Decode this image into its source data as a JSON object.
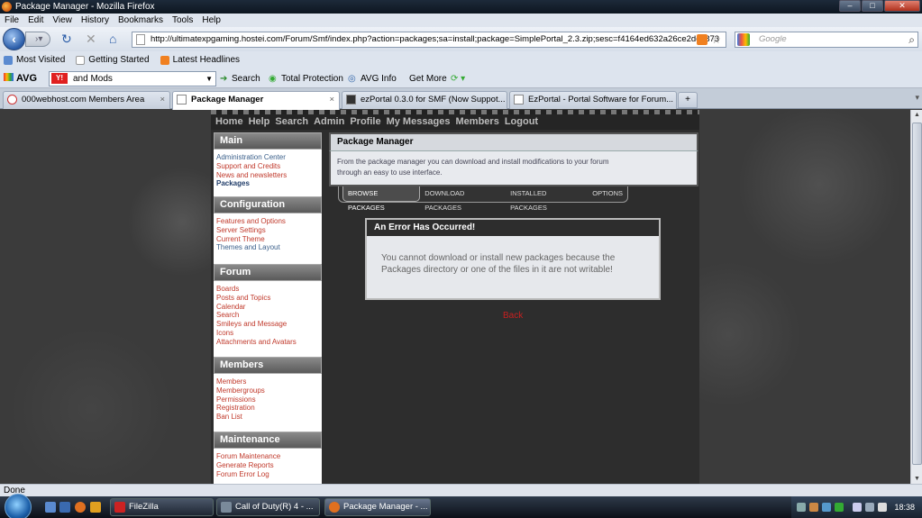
{
  "window": {
    "title": "Package Manager - Mozilla Firefox"
  },
  "menu": [
    "File",
    "Edit",
    "View",
    "History",
    "Bookmarks",
    "Tools",
    "Help"
  ],
  "nav": {
    "url": "http://ultimatexpgaming.hostei.com/Forum/Smf/index.php?action=packages;sa=install;package=SimplePortal_2.3.zip;sesc=f4164ed632a26ce2ddc873",
    "search_placeholder": "Google"
  },
  "bookmarks": [
    "Most Visited",
    "Getting Started",
    "Latest Headlines"
  ],
  "avg_toolbar": {
    "brand": "AVG",
    "search_value": "and Mods",
    "search_label": "Search",
    "total_protection": "Total Protection",
    "avg_info": "AVG Info",
    "get_more": "Get More"
  },
  "tabs": [
    {
      "label": "000webhost.com Members Area",
      "active": false
    },
    {
      "label": "Package Manager",
      "active": true
    },
    {
      "label": "ezPortal 0.3.0 for SMF (Now Suppot...",
      "active": false
    },
    {
      "label": "EzPortal - Portal Software for Forum...",
      "active": false
    }
  ],
  "forum_nav": [
    "Home",
    "Help",
    "Search",
    "Admin",
    "Profile",
    "My Messages",
    "Members",
    "Logout"
  ],
  "sidebar": {
    "main": {
      "title": "Main",
      "items": [
        "Administration Center",
        "Support and Credits",
        "News and newsletters",
        "Packages"
      ]
    },
    "configuration": {
      "title": "Configuration",
      "items": [
        "Features and Options",
        "Server Settings",
        "Current Theme",
        "Themes and Layout"
      ]
    },
    "forum": {
      "title": "Forum",
      "items": [
        "Boards",
        "Posts and Topics",
        "Calendar",
        "Search",
        "Smileys and Message",
        "Icons",
        "Attachments and Avatars"
      ]
    },
    "members": {
      "title": "Members",
      "items": [
        "Members",
        "Membergroups",
        "Permissions",
        "Registration",
        "Ban List"
      ]
    },
    "maintenance": {
      "title": "Maintenance",
      "items": [
        "Forum Maintenance",
        "Generate Reports",
        "Forum Error Log"
      ]
    }
  },
  "package_manager": {
    "title": "Package Manager",
    "description_line1": "From the package manager you can download and install modifications to your forum",
    "description_line2": "through an easy to use interface.",
    "tabs": [
      "BROWSE PACKAGES",
      "DOWNLOAD PACKAGES",
      "INSTALLED PACKAGES",
      "OPTIONS"
    ]
  },
  "error": {
    "title": "An Error Has Occurred!",
    "message": "You cannot download or install new packages because the Packages directory or one of the files in it are not writable!",
    "back": "Back"
  },
  "status": "Done",
  "taskbar": {
    "tasks": [
      "FileZilla",
      "Call of Duty(R) 4 - ...",
      "Package Manager - ..."
    ],
    "clock": "18:38"
  }
}
